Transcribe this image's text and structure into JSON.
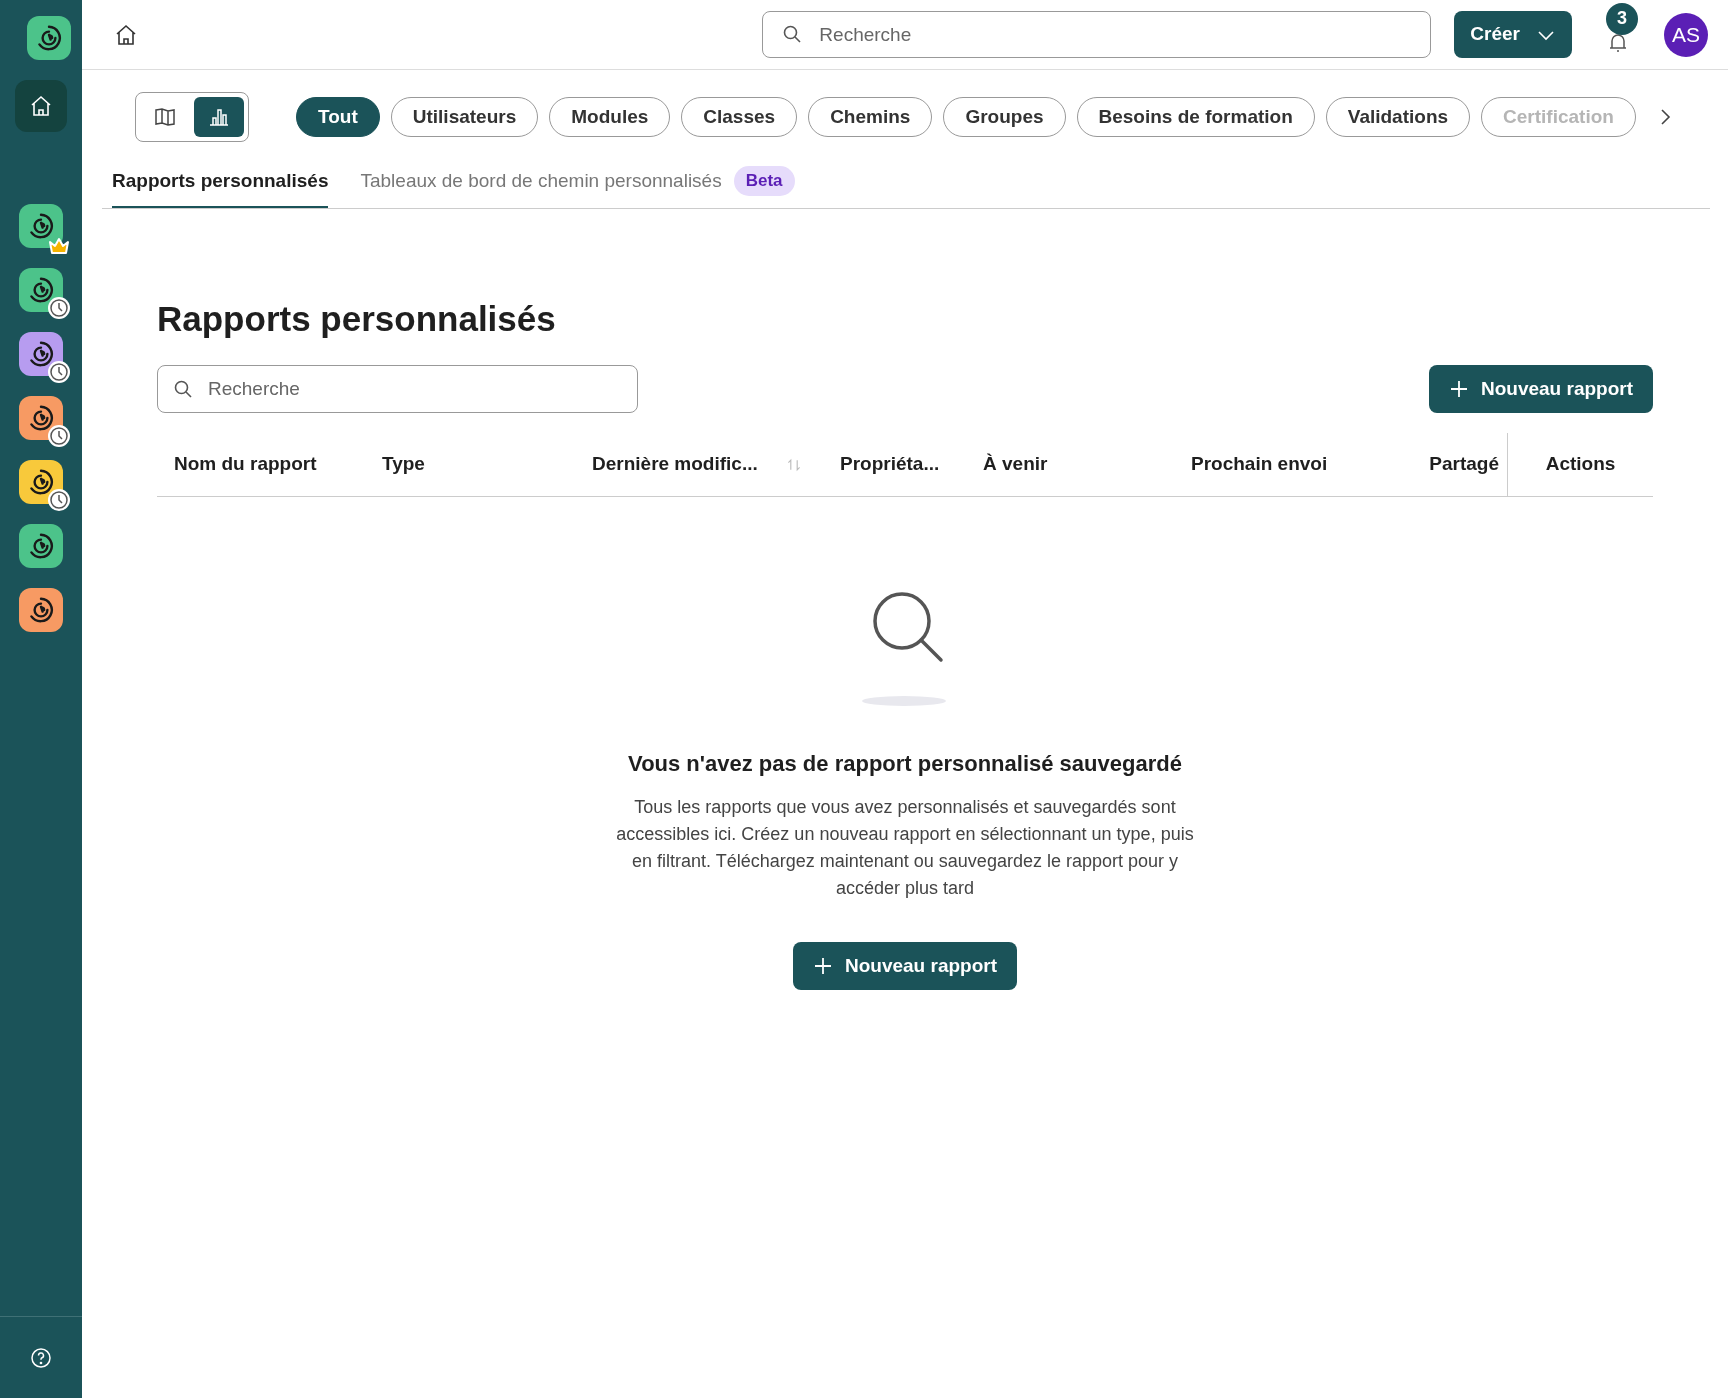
{
  "sidebar": {
    "apps": [
      {
        "color": "#4cc38a",
        "kind": "plain"
      },
      {
        "color": "#4cc38a",
        "kind": "crown"
      },
      {
        "color": "#4cc38a",
        "kind": "clock"
      },
      {
        "color": "#b79cf0",
        "kind": "clock"
      },
      {
        "color": "#f79a63",
        "kind": "clock"
      },
      {
        "color": "#f8c93b",
        "kind": "clock"
      },
      {
        "color": "#4cc38a",
        "kind": "plain"
      },
      {
        "color": "#f79a63",
        "kind": "plain"
      }
    ]
  },
  "topbar": {
    "search": {
      "placeholder": "Recherche"
    },
    "create_button": "Créer",
    "notifications": "3",
    "avatar": "AS"
  },
  "view_toggle": [
    {
      "kind": "book",
      "selected": false
    },
    {
      "kind": "chart",
      "selected": true
    }
  ],
  "filters": [
    {
      "label": "Tout",
      "selected": true,
      "faded": false
    },
    {
      "label": "Utilisateurs",
      "selected": false,
      "faded": false
    },
    {
      "label": "Modules",
      "selected": false,
      "faded": false
    },
    {
      "label": "Classes",
      "selected": false,
      "faded": false
    },
    {
      "label": "Chemins",
      "selected": false,
      "faded": false
    },
    {
      "label": "Groupes",
      "selected": false,
      "faded": false
    },
    {
      "label": "Besoins de formation",
      "selected": false,
      "faded": false
    },
    {
      "label": "Validations",
      "selected": false,
      "faded": false
    },
    {
      "label": "Certification",
      "selected": false,
      "faded": true
    }
  ],
  "tabs": [
    {
      "label": "Rapports personnalisés",
      "selected": true
    },
    {
      "label": "Tableaux de bord de chemin personnalisés",
      "selected": false,
      "badge": "Beta"
    }
  ],
  "page": {
    "title": "Rapports personnalisés",
    "search": {
      "placeholder": "Recherche"
    },
    "new_button": "Nouveau rapport"
  },
  "table": {
    "columns": [
      {
        "label": "Nom du rapport",
        "sortable": false
      },
      {
        "label": "Type",
        "sortable": false
      },
      {
        "label": "Dernière modific...",
        "sortable": true
      },
      {
        "label": "Propriéta...",
        "sortable": false
      },
      {
        "label": "À venir",
        "sortable": false
      },
      {
        "label": "Prochain envoi",
        "sortable": false
      },
      {
        "label": "Partagé",
        "sortable": false
      },
      {
        "label": "Actions",
        "sortable": false
      }
    ]
  },
  "empty_state": {
    "title": "Vous n'avez pas de rapport personnalisé sauvegardé",
    "text": "Tous les rapports que vous avez personnalisés et sauvegardés sont accessibles ici. Créez un nouveau rapport en sélectionnant un type, puis en filtrant. Téléchargez maintenant ou sauvegardez le rapport pour y accéder plus tard",
    "button": "Nouveau rapport"
  }
}
